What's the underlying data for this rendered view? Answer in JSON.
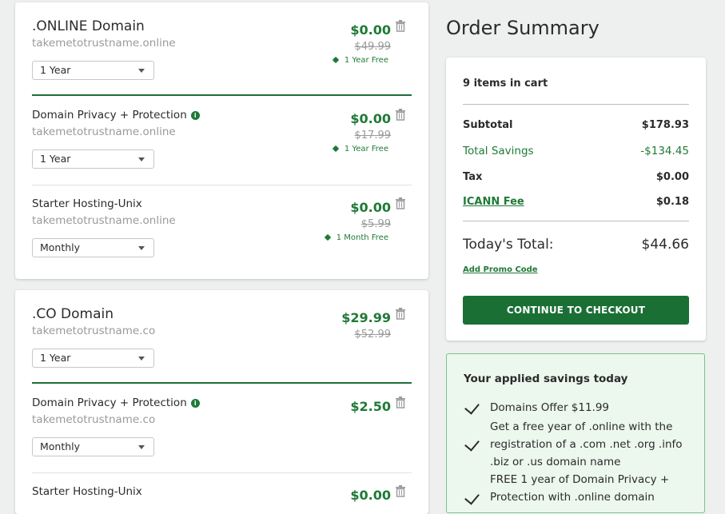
{
  "products": [
    {
      "items": [
        {
          "title": ".ONLINE Domain",
          "domain": "takemetotrustname.online",
          "term": "1 Year",
          "price": "$0.00",
          "original": "$49.99",
          "promo": "1 Year Free"
        },
        {
          "title": "Domain Privacy + Protection",
          "domain": "takemetotrustname.online",
          "term": "1 Year",
          "price": "$0.00",
          "original": "$17.99",
          "promo": "1 Year Free"
        },
        {
          "title": "Starter Hosting-Unix",
          "domain": "takemetotrustname.online",
          "term": "Monthly",
          "price": "$0.00",
          "original": "$5.99",
          "promo": "1 Month Free"
        }
      ]
    },
    {
      "items": [
        {
          "title": ".CO Domain",
          "domain": "takemetotrustname.co",
          "term": "1 Year",
          "price": "$29.99",
          "original": "$52.99"
        },
        {
          "title": "Domain Privacy + Protection",
          "domain": "takemetotrustname.co",
          "term": "Monthly",
          "price": "$2.50"
        },
        {
          "title": "Starter Hosting-Unix",
          "price": "$0.00"
        }
      ]
    }
  ],
  "summary": {
    "heading": "Order Summary",
    "items_in_cart": "9 items in cart",
    "subtotal_label": "Subtotal",
    "subtotal": "$178.93",
    "savings_label": "Total Savings",
    "savings": "-$134.45",
    "tax_label": "Tax",
    "tax": "$0.00",
    "icann_label": "ICANN Fee",
    "icann": "$0.18",
    "total_label": "Today's Total:",
    "total": "$44.66",
    "promo_link": "Add Promo Code",
    "checkout_button": "CONTINUE TO CHECKOUT"
  },
  "applied_savings": {
    "heading": "Your applied savings today",
    "items": [
      "Domains Offer $11.99",
      "Get a free year of .online with the registration of a .com .net .org .info .biz or .us domain name",
      "FREE 1 year of Domain Privacy + Protection with .online domain"
    ]
  },
  "colors": {
    "accent": "#1f7a36",
    "button": "#1a6f35",
    "savings_bg": "#ecf7ee"
  },
  "icons": {
    "trash": "trash-icon",
    "info": "info-icon",
    "tag": "tag-icon",
    "check": "check-icon",
    "caret": "chevron-down-icon"
  }
}
